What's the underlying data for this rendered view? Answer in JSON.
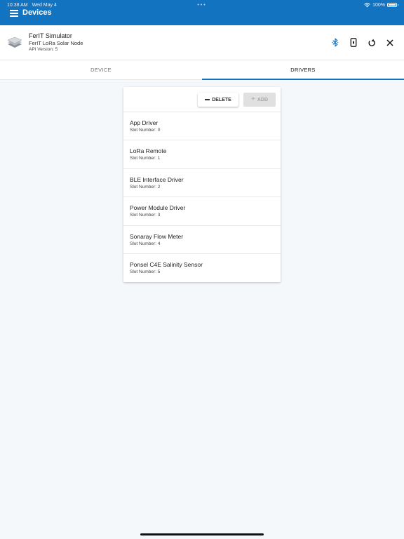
{
  "status_bar": {
    "time": "10:38 AM",
    "date": "Wed May 4",
    "battery": "100%"
  },
  "appbar": {
    "title": "Devices"
  },
  "device": {
    "name": "FerIT Simulator",
    "model": "FerIT LoRa Solar Node",
    "api_version": "API Version: 5"
  },
  "tabs": [
    {
      "label": "DEVICE",
      "active": false
    },
    {
      "label": "DRIVERS",
      "active": true
    }
  ],
  "toolbar": {
    "delete_label": "DELETE",
    "add_label": "ADD"
  },
  "drivers": [
    {
      "name": "App Driver",
      "slot": "Slot Number: 0"
    },
    {
      "name": "LoRa Remote",
      "slot": "Slot Number: 1"
    },
    {
      "name": "BLE Interface Driver",
      "slot": "Slot Number: 2"
    },
    {
      "name": "Power Module Driver",
      "slot": "Slot Number: 3"
    },
    {
      "name": "Sonaray Flow Meter",
      "slot": "Slot Number: 4"
    },
    {
      "name": "Ponsel C4E Salinity Sensor",
      "slot": "Slot Number: 5"
    }
  ],
  "icons": {
    "menu": "menu-icon",
    "device": "device-stack-icon",
    "bluetooth": "bluetooth-icon",
    "phone": "phone-icon",
    "refresh": "refresh-icon",
    "close": "close-icon"
  },
  "colors": {
    "primary": "#1273c0",
    "background": "#f5f8fb"
  }
}
